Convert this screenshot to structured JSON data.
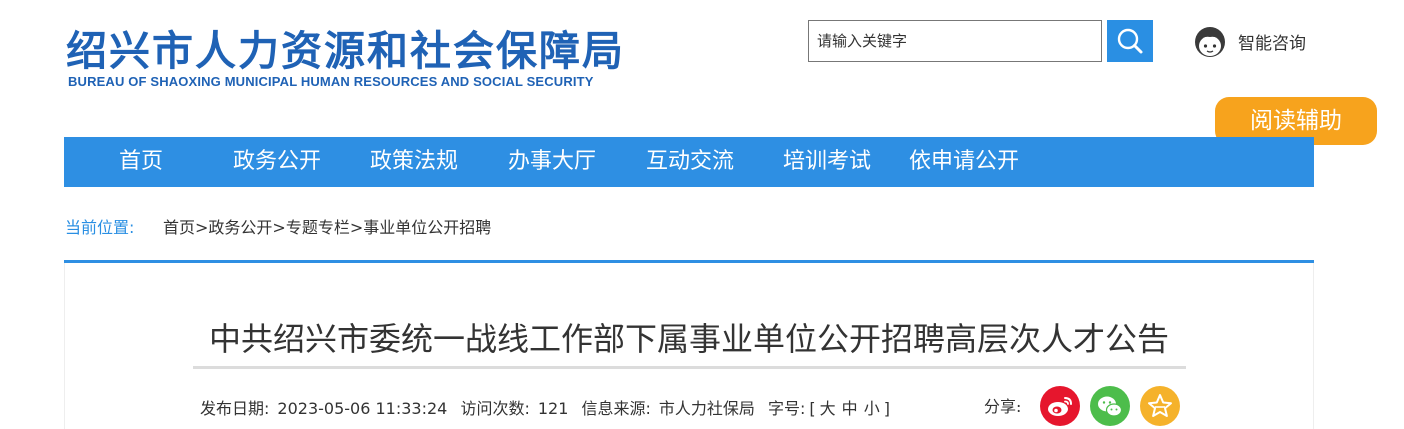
{
  "header": {
    "logo_cn": "绍兴市人力资源和社会保障局",
    "logo_en": "BUREAU OF SHAOXING MUNICIPAL HUMAN RESOURCES AND SOCIAL SECURITY"
  },
  "search": {
    "placeholder": "请输入关键字"
  },
  "ai_consult": {
    "label": "智能咨询"
  },
  "read_assist": {
    "label": "阅读辅助"
  },
  "nav": {
    "items": [
      "首页",
      "政务公开",
      "政策法规",
      "办事大厅",
      "互动交流",
      "培训考试",
      "依申请公开"
    ]
  },
  "breadcrumb": {
    "label": "当前位置:",
    "path": "首页>政务公开>专题专栏>事业单位公开招聘"
  },
  "article": {
    "title": "中共绍兴市委统一战线工作部下属事业单位公开招聘高层次人才公告",
    "publish_label": "发布日期:",
    "publish_date": "2023-05-06 11:33:24",
    "visits_label": "访问次数:",
    "visits": "121",
    "source_label": "信息来源:",
    "source": "市人力社保局",
    "font_label": "字号:",
    "font_open": "[",
    "font_large": "大",
    "font_medium": "中",
    "font_small": "小",
    "font_close": "]"
  },
  "share": {
    "label": "分享:",
    "buttons": [
      {
        "icon": "weibo-icon",
        "color": "#e6162d"
      },
      {
        "icon": "wechat-icon",
        "color": "#4dbd4b"
      },
      {
        "icon": "favorite-star-icon",
        "color": "#f5b22b"
      }
    ]
  },
  "colors": {
    "brand_blue": "#1f62b5",
    "nav_blue": "#2e8fe3",
    "accent_orange": "#f7a31d"
  }
}
